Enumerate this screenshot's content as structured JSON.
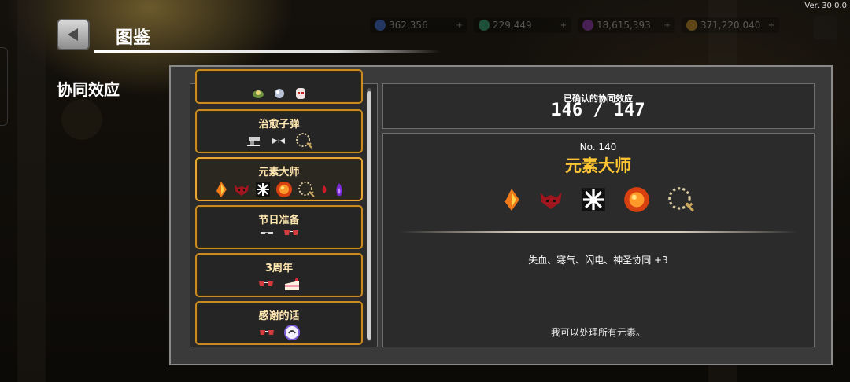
{
  "header": {
    "title": "图鉴",
    "version": "Ver. 30.0.0",
    "currencies": [
      {
        "icon": "diamond-icon",
        "value": "362,356",
        "color": "#3d7cff"
      },
      {
        "icon": "gem-icon",
        "value": "229,449",
        "color": "#33c48a"
      },
      {
        "icon": "crystal-icon",
        "value": "18,615,393",
        "color": "#a33cd6"
      },
      {
        "icon": "gold-icon",
        "value": "371,220,040",
        "color": "#e0a02a"
      }
    ]
  },
  "sidebar": {
    "section_label": "协同效应"
  },
  "synergy_list": {
    "items": [
      {
        "title": "",
        "icons": [
          "healing-item-icon",
          "orb-icon",
          "mask-icon"
        ]
      },
      {
        "title": "治愈子弹",
        "icons": [
          "pistol-icon",
          "wings-icon",
          "rosary-icon"
        ]
      },
      {
        "title": "元素大师",
        "icons": [
          "fire-crystal-icon",
          "demon-icon",
          "snowflake-icon",
          "fire-orb-icon",
          "rosary-icon",
          "blood-drop-icon",
          "purple-flame-icon"
        ]
      },
      {
        "title": "节日准备",
        "icons": [
          "glasses-icon",
          "red-glasses-icon"
        ]
      },
      {
        "title": "3周年",
        "icons": [
          "red-glasses-icon",
          "cake-icon"
        ]
      },
      {
        "title": "感谢的话",
        "icons": [
          "red-glasses-icon",
          "letter-icon"
        ]
      }
    ]
  },
  "summary": {
    "label": "已确认的协同效应",
    "value": "146 / 147"
  },
  "detail": {
    "number": "No. 140",
    "title": "元素大师",
    "icons": [
      "fire-crystal-icon",
      "demon-icon",
      "snowflake-icon",
      "fire-orb-icon",
      "rosary-icon"
    ],
    "effect": "失血、寒气、闪电、神圣协同 +3",
    "description": "我可以处理所有元素。"
  },
  "colors": {
    "accent_gold": "#ffc533",
    "item_border": "#c98a22",
    "panel_bg": "#3a3a3a"
  }
}
